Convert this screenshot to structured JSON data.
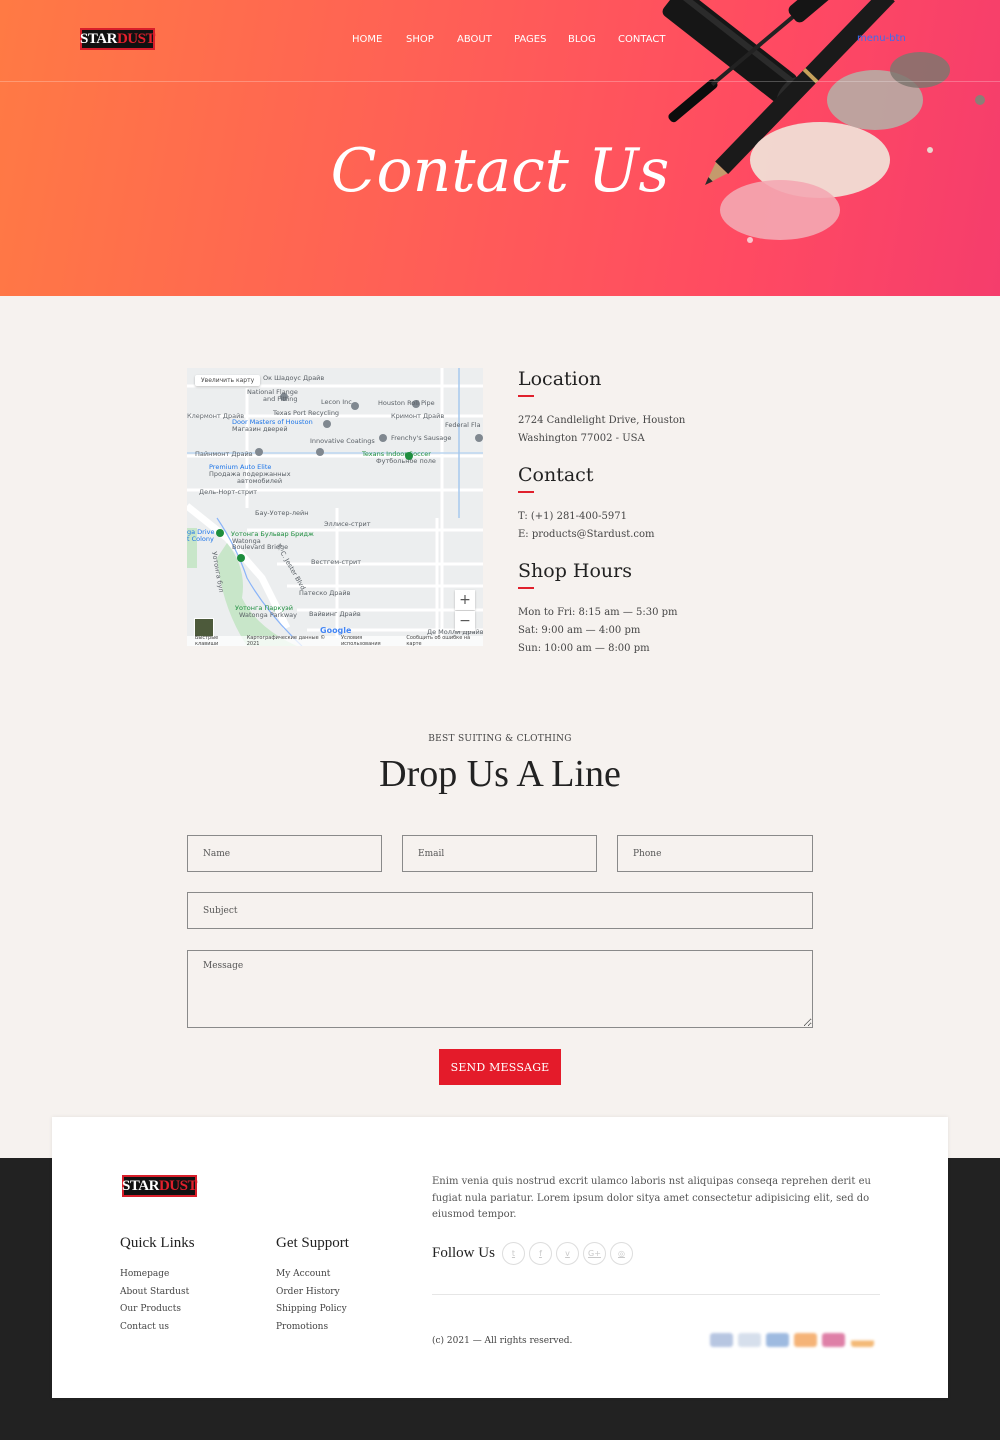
{
  "header": {
    "logo_text": "STARDUST",
    "nav": [
      "HOME",
      "SHOP",
      "ABOUT",
      "PAGES",
      "BLOG",
      "CONTACT"
    ],
    "menu_button_alt": "menu-btn",
    "page_title": "Contact Us"
  },
  "map": {
    "enlarge_label": "Увеличить карту",
    "zoom_in": "+",
    "zoom_out": "−",
    "labels": [
      "Ок Шадоус Драйв",
      "National Flange",
      "and Fitting",
      "Lecon Inc",
      "Houston Roll Pipe",
      "Клермонт Драйв",
      "Texas Port Recycling",
      "Кримонт Драйв",
      "Door Masters of Houston",
      "Магазин дверей",
      "Federal Fla",
      "Innovative Coatings",
      "Frenchy's Sausage",
      "Пайнмонт Драйв",
      "Texans Indoor Soccer",
      "Футбольное поле",
      "Premium Auto Elite",
      "Продажа подержанных",
      "автомобилей",
      "Дель-Норт-стрит",
      "Бау-Уотер-лейн",
      "Эллисе-стрит",
      "Уотонга Бульвар Бридж",
      "Watonga",
      "Boulevard Bridge",
      "ga Drive",
      "t Colony",
      "Вестгем-стрит",
      "Патеско Драйв",
      "Уотонга Паркуэй",
      "Watonga Parkway",
      "Вайвинг Драйв",
      "Де Молли Драйв",
      "Т. С. Jester Blvd",
      "Уотонга бул"
    ],
    "google": "Google",
    "footer_links": [
      "Быстрые клавиши",
      "Картографические данные © 2021",
      "Условия использования",
      "Сообщить об ошибке на карте"
    ]
  },
  "info": {
    "location": {
      "title": "Location",
      "lines": [
        "2724 Candlelight Drive, Houston",
        "Washington 77002 - USA"
      ]
    },
    "contact": {
      "title": "Contact",
      "lines": [
        "T: (+1) 281-400-5971",
        "E: products@Stardust.com"
      ]
    },
    "hours": {
      "title": "Shop Hours",
      "lines": [
        "Mon to Fri: 8:15 am — 5:30 pm",
        "Sat: 9:00 am — 4:00 pm",
        "Sun: 10:00 am — 8:00 pm"
      ]
    }
  },
  "form": {
    "eyebrow": "BEST SUITING & CLOTHING",
    "title": "Drop Us A Line",
    "name_placeholder": "Name",
    "email_placeholder": "Email",
    "phone_placeholder": "Phone",
    "subject_placeholder": "Subject",
    "message_placeholder": "Message",
    "send_label": "SEND MESSAGE"
  },
  "footer": {
    "logo_text": "STARDUST",
    "description": "Enim venia quis nostrud excrit ulamco laboris nst aliquipas conseqa reprehen derit eu fugiat nula pariatur. Lorem ipsum dolor sitya amet consectetur adipisicing elit, sed do eiusmod tempor.",
    "quick_links": {
      "title": "Quick Links",
      "items": [
        "Homepage",
        "About Stardust",
        "Our Products",
        "Contact us"
      ]
    },
    "support": {
      "title": "Get Support",
      "items": [
        "My Account",
        "Order History",
        "Shipping Policy",
        "Promotions"
      ]
    },
    "follow_title": "Follow Us",
    "social_icons": [
      "twitter-icon",
      "facebook-icon",
      "vimeo-icon",
      "google-plus-icon",
      "instagram-icon"
    ],
    "social_glyphs": [
      "t",
      "f",
      "v",
      "G+",
      "◎"
    ],
    "copyright": "(c) 2021 — All rights reserved.",
    "payment_icons": [
      "visa-icon",
      "amex-icon",
      "paypal-icon",
      "mastercard-icon",
      "maestro-icon",
      "discover-icon"
    ],
    "payment_colors": [
      "#9fb3d8",
      "#c9d5e6",
      "#7ea3d6",
      "#f29a4b",
      "#d4568a",
      "#f0a24a"
    ]
  },
  "colors": {
    "accent": "#e41b2a",
    "hero_start": "#ff7a44",
    "hero_end": "#f53d6c",
    "footer_dark": "#222222"
  }
}
